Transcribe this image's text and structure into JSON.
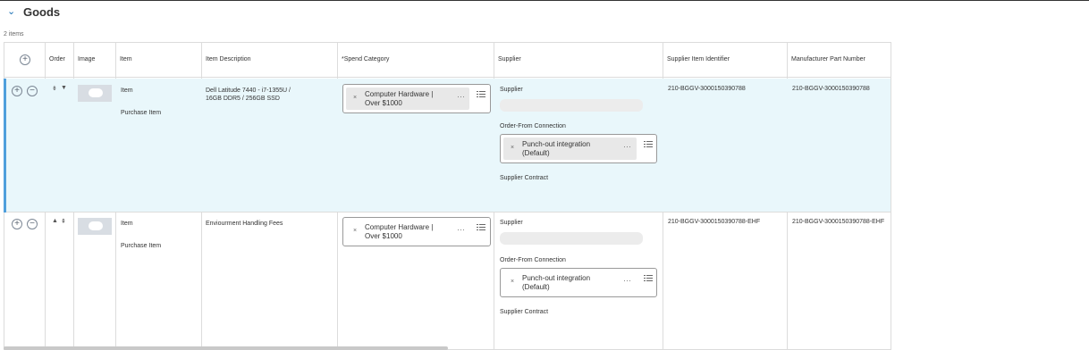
{
  "section": {
    "title": "Goods",
    "count_text": "2 items"
  },
  "headers": {
    "add": "+",
    "order": "Order",
    "image": "Image",
    "item": "Item",
    "description": "Item Description",
    "spend_category": "*Spend Category",
    "supplier": "Supplier",
    "supplier_item_id": "Supplier Item Identifier",
    "mfr_part": "Manufacturer Part Number"
  },
  "rows": [
    {
      "item_label": "Item",
      "item_type": "Purchase Item",
      "description": "Dell Latitude 7440 - i7-1355U / 16GB DDR5 / 256GB SSD",
      "spend_category": "Computer Hardware | Over $1000",
      "supplier_label": "Supplier",
      "order_from_label": "Order-From Connection",
      "order_from_value": "Punch-out integration (Default)",
      "supplier_contract_label": "Supplier Contract",
      "supplier_item_id": "210-BGGV-3000150390788",
      "mfr_part": "210-BGGV-3000150390788"
    },
    {
      "item_label": "Item",
      "item_type": "Purchase Item",
      "description": "Enviourment Handling Fees",
      "spend_category": "Computer Hardware | Over $1000",
      "supplier_label": "Supplier",
      "order_from_label": "Order-From Connection",
      "order_from_value": "Punch-out integration (Default)",
      "supplier_contract_label": "Supplier Contract",
      "supplier_item_id": "210-BGGV-3000150390788-EHF",
      "mfr_part": "210-BGGV-3000150390788-EHF"
    }
  ],
  "glyphs": {
    "plus": "+",
    "minus": "−",
    "remove": "×",
    "more": "···",
    "chevron": "⌄",
    "move_down_top": "⇟",
    "move_down": "▼",
    "move_up": "▲",
    "move_up_top": "⇞"
  },
  "colors": {
    "selected_row_bg": "#e9f7fb",
    "selected_row_accent": "#4f9fdc",
    "chevron": "#1a6fb5"
  }
}
